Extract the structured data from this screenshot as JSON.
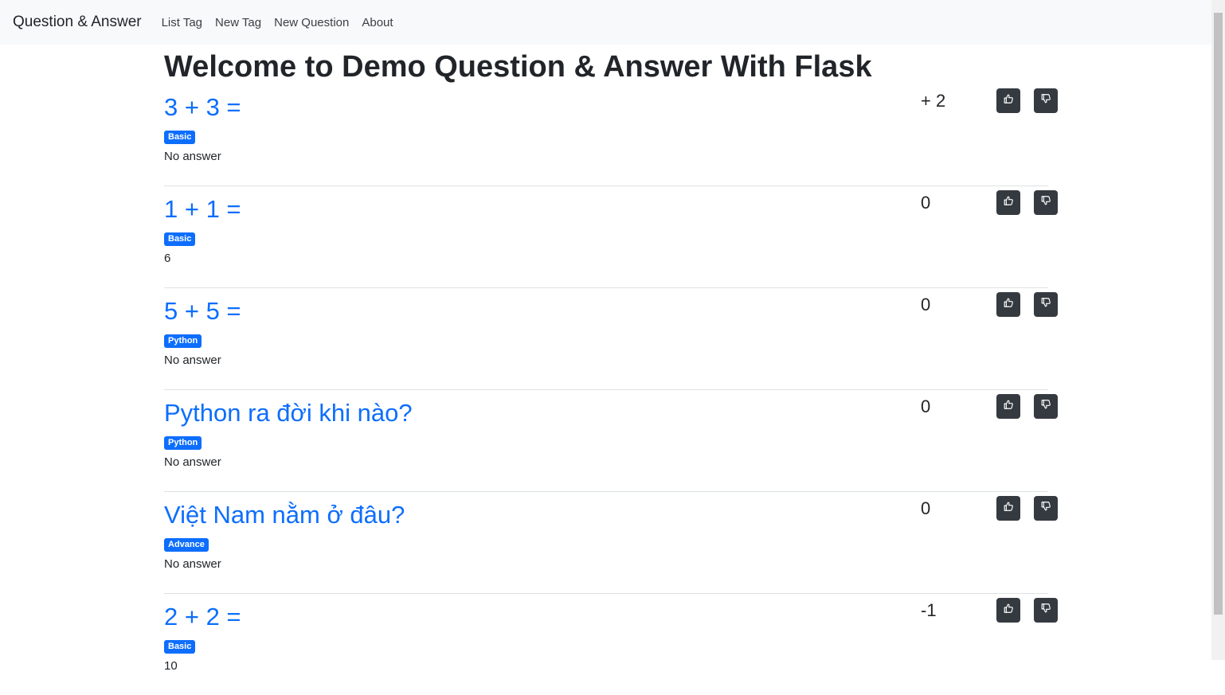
{
  "navbar": {
    "brand": "Question & Answer",
    "links": [
      {
        "label": "List Tag"
      },
      {
        "label": "New Tag"
      },
      {
        "label": "New Question"
      },
      {
        "label": "About"
      }
    ]
  },
  "main": {
    "title": "Welcome to Demo Question & Answer With Flask",
    "questions": [
      {
        "title": "3 + 3 =",
        "tag": "Basic",
        "answer": "No answer",
        "votes": "+ 2"
      },
      {
        "title": "1 + 1 =",
        "tag": "Basic",
        "answer": "6",
        "votes": "0"
      },
      {
        "title": "5 + 5 =",
        "tag": "Python",
        "answer": "No answer",
        "votes": "0"
      },
      {
        "title": "Python ra đời khi nào?",
        "tag": "Python",
        "answer": "No answer",
        "votes": "0"
      },
      {
        "title": "Việt Nam nằm ở đâu?",
        "tag": "Advance",
        "answer": "No answer",
        "votes": "0"
      },
      {
        "title": "2 + 2 =",
        "tag": "Basic",
        "answer": "10",
        "votes": "-1"
      }
    ]
  },
  "icons": {
    "upvote": "thumbs-up-icon",
    "downvote": "thumbs-down-icon"
  },
  "colors": {
    "link": "#0d6efd",
    "badge": "#0d6efd",
    "button": "#343a40",
    "navbar_bg": "#f8f9fa"
  }
}
